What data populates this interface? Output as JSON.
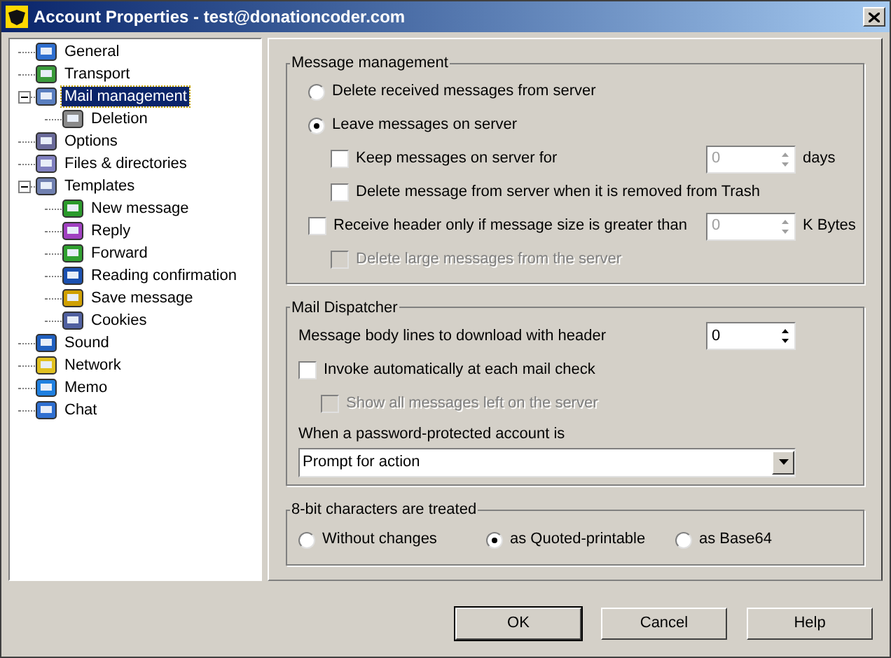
{
  "window": {
    "title": "Account Properties - test@donationcoder.com"
  },
  "tree": [
    {
      "label": "General",
      "selected": false
    },
    {
      "label": "Transport",
      "selected": false
    },
    {
      "label": "Mail management",
      "selected": true,
      "expanded": true,
      "children": [
        {
          "label": "Deletion",
          "selected": false
        }
      ]
    },
    {
      "label": "Options",
      "selected": false
    },
    {
      "label": "Files & directories",
      "selected": false
    },
    {
      "label": "Templates",
      "selected": false,
      "expanded": true,
      "children": [
        {
          "label": "New message",
          "selected": false
        },
        {
          "label": "Reply",
          "selected": false
        },
        {
          "label": "Forward",
          "selected": false
        },
        {
          "label": "Reading confirmation",
          "selected": false
        },
        {
          "label": "Save message",
          "selected": false
        },
        {
          "label": "Cookies",
          "selected": false
        }
      ]
    },
    {
      "label": "Sound",
      "selected": false
    },
    {
      "label": "Network",
      "selected": false
    },
    {
      "label": "Memo",
      "selected": false
    },
    {
      "label": "Chat",
      "selected": false
    }
  ],
  "groups": [
    {
      "title": "Message management",
      "rows": [
        {
          "kind": "radio",
          "label": "Delete received messages from server",
          "selected": false
        },
        {
          "kind": "radio",
          "label": "Leave messages on server",
          "selected": true,
          "children": [
            {
              "kind": "checkbox",
              "label": "Keep messages on server for",
              "checked": false,
              "disabled": false,
              "spin": {
                "value": "0",
                "disabled": true
              },
              "unit": "days"
            },
            {
              "kind": "checkbox",
              "label": "Delete message from server when it is removed from Trash",
              "checked": false,
              "disabled": false
            }
          ]
        },
        {
          "kind": "checkbox",
          "label": "Receive header only if message size is greater than",
          "checked": false,
          "disabled": false,
          "spin": {
            "value": "0",
            "disabled": true
          },
          "unit": "K Bytes",
          "children": [
            {
              "kind": "checkbox",
              "label": "Delete large messages from the server",
              "checked": false,
              "disabled": true
            }
          ]
        }
      ]
    },
    {
      "title": "Mail Dispatcher",
      "rows": [
        {
          "kind": "spin",
          "label": "Message body lines to download with header",
          "spin": {
            "value": "0",
            "disabled": false
          }
        },
        {
          "kind": "checkbox",
          "label": "Invoke automatically at each mail check",
          "checked": false,
          "disabled": false,
          "children": [
            {
              "kind": "checkbox",
              "label": "Show all messages left on the server",
              "checked": false,
              "disabled": true
            }
          ]
        },
        {
          "kind": "label",
          "label": "When a password-protected account is"
        },
        {
          "kind": "dropdown",
          "value": "Prompt for action"
        }
      ]
    },
    {
      "title": "8-bit characters are treated",
      "rows": [
        {
          "kind": "radio-group",
          "options": [
            {
              "label": "Without changes",
              "selected": false
            },
            {
              "label": "as Quoted-printable",
              "selected": true
            },
            {
              "label": "as Base64",
              "selected": false
            }
          ]
        }
      ]
    }
  ],
  "buttons": [
    {
      "label": "OK",
      "default": true
    },
    {
      "label": "Cancel",
      "default": false
    },
    {
      "label": "Help",
      "default": false
    }
  ]
}
